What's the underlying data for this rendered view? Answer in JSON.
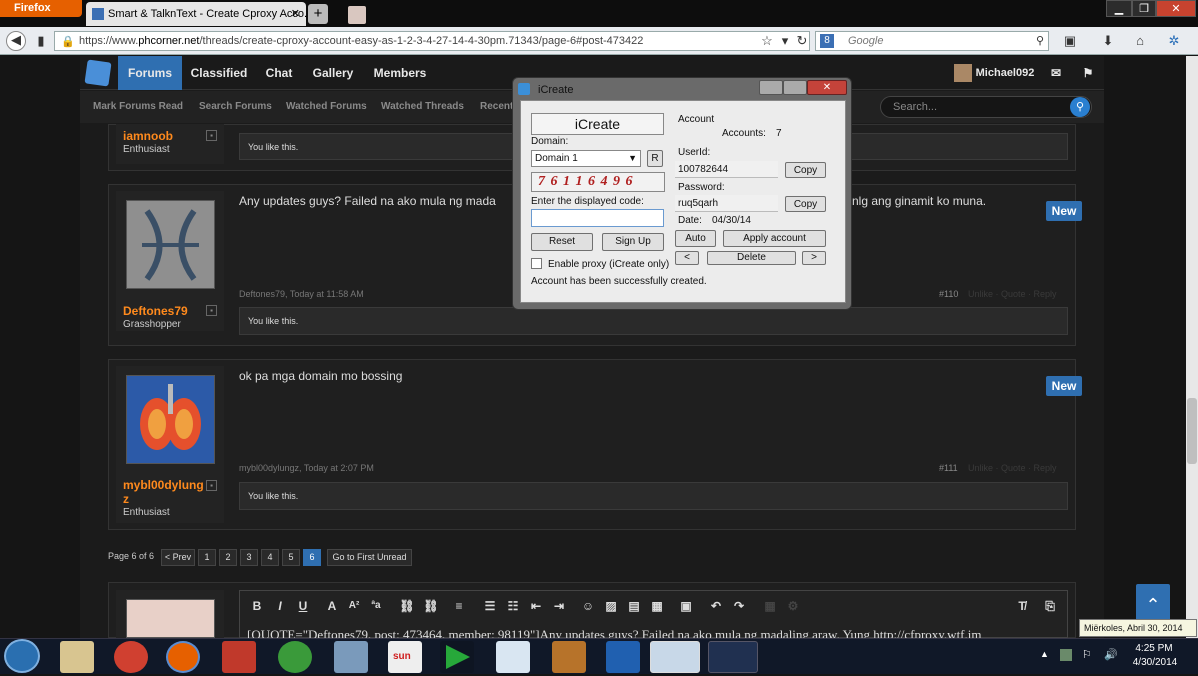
{
  "browser": {
    "menu": "Firefox",
    "tab_title": "Smart & TalknText - Create Cproxy Acco...",
    "url_prefix": "https://www.",
    "url_host": "phcorner.net",
    "url_path": "/threads/create-cproxy-account-easy-as-1-2-3-4-27-14-4-30pm.71343/page-6#post-473422",
    "search_placeholder": "Google",
    "search_engine_letter": "8"
  },
  "site": {
    "nav": [
      "Forums",
      "Classified",
      "Chat",
      "Gallery",
      "Members"
    ],
    "user": "Michael092",
    "subnav": [
      "Mark Forums Read",
      "Search Forums",
      "Watched Forums",
      "Watched Threads",
      "Recent"
    ],
    "search_placeholder": "Search..."
  },
  "posts": [
    {
      "username": "iamnoob",
      "title": "Enthusiast",
      "like": "You like this."
    },
    {
      "username": "Deftones79",
      "title": "Grasshopper",
      "message_left": "Any updates guys? Failed na ako mula ng mada",
      "message_right": "nlg ang ginamit ko muna.",
      "meta": "Deftones79, Today at 11:58 AM",
      "number": "#110",
      "actions": "Unlike  ·  Quote  ·  Reply",
      "badge": "New",
      "like": "You like this."
    },
    {
      "username": "mybl00dylung z",
      "title": "Enthusiast",
      "message": "ok pa mga domain mo bossing",
      "meta": "mybl00dylungz, Today at 2:07 PM",
      "number": "#111",
      "actions": "Unlike  ·  Quote  ·  Reply",
      "badge": "New",
      "like": "You like this."
    }
  ],
  "pagination": {
    "label": "Page 6 of 6",
    "prev": "< Prev",
    "pages": [
      "1",
      "2",
      "3",
      "4",
      "5",
      "6"
    ],
    "current": "6",
    "first_unread": "Go to First Unread"
  },
  "editor": {
    "text": "[QUOTE=\"Deftones79, post: 473464, member: 98119\"]Any updates guys? Failed na ako mula ng madaling araw. Yung http://cfproxy.wtf.im"
  },
  "dialog": {
    "title": "iCreate",
    "heading": "iCreate",
    "domain_label": "Domain:",
    "domain_value": "Domain 1",
    "refresh": "R",
    "captcha": "7 6 1 1 6 4 9 6",
    "code_label": "Enter the displayed code:",
    "reset": "Reset",
    "signup": "Sign Up",
    "proxy_label": "Enable proxy (iCreate only)",
    "status": "Account has been successfully created.",
    "account_heading": "Account",
    "accounts_label": "Accounts:",
    "accounts_count": "7",
    "userid_label": "UserId:",
    "userid": "100782644",
    "password_label": "Password:",
    "password": "ruq5qarh",
    "copy": "Copy",
    "date_label": "Date:",
    "date": "04/30/14",
    "auto": "Auto",
    "apply": "Apply account",
    "prev": "<",
    "delete": "Delete",
    "next": ">"
  },
  "taskbar": {
    "time": "4:25 PM",
    "date": "4/30/2014",
    "tooltip": "Miërkoles, Abril 30, 2014"
  }
}
